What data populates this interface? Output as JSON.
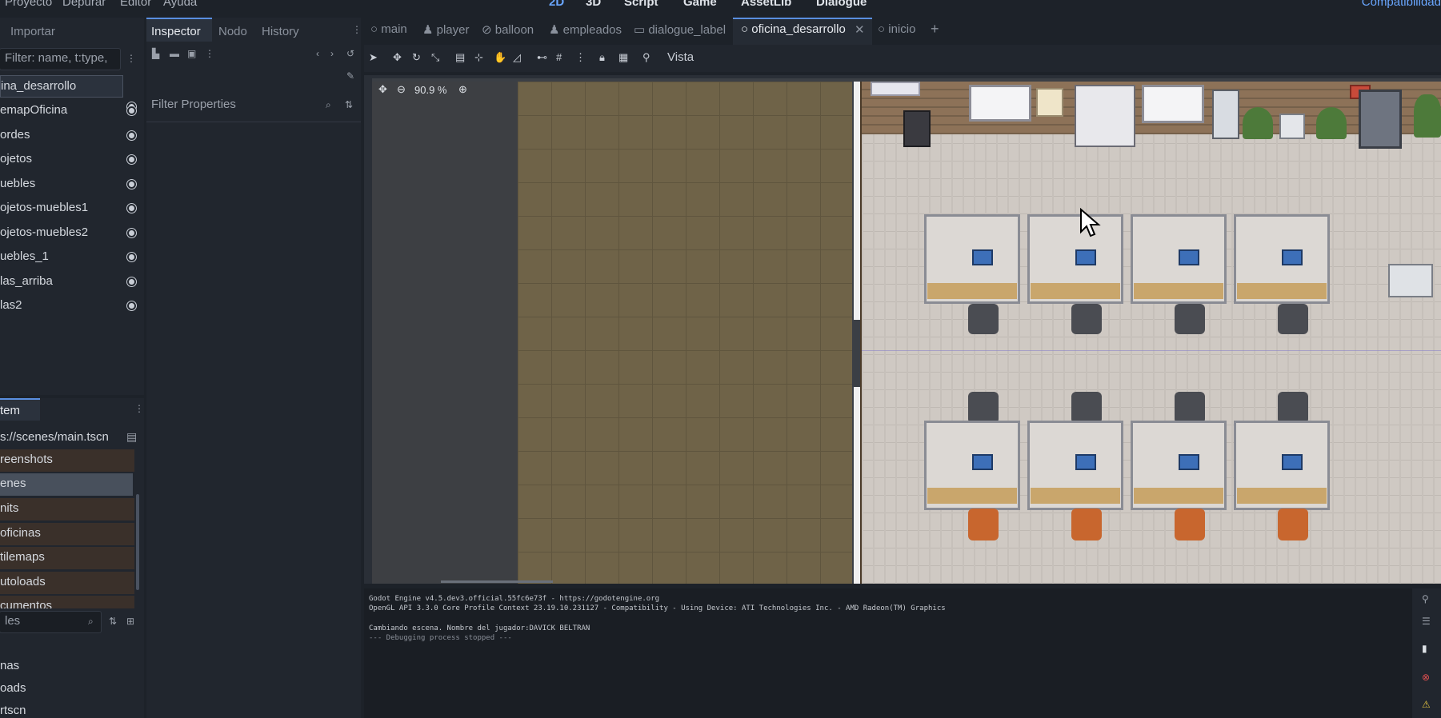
{
  "menu": {
    "items": [
      "Proyecto",
      "Depurar",
      "Editor",
      "Ayuda"
    ],
    "workspaces": [
      "2D",
      "3D",
      "Script",
      "Game",
      "AssetLib",
      "Dialogue"
    ],
    "renderer": "Compatibilidad"
  },
  "left_dock": {
    "tab": "Importar",
    "filter_placeholder": "Filter: name, t:type,",
    "tree": [
      "ina_desarrollo",
      "emapOficina",
      "ordes",
      "ojetos",
      "uebles",
      "ojetos-muebles1",
      "ojetos-muebles2",
      "uebles_1",
      "las_arriba",
      "las2"
    ],
    "fs_tab": "tem",
    "path": "s://scenes/main.tscn",
    "fs_items": [
      "reenshots",
      "enes",
      "nits",
      "oficinas",
      "tilemaps",
      "utoloads",
      "cumentos"
    ],
    "bottom_filter": "les",
    "bottom_items": [
      "nas",
      "oads",
      "rtscn"
    ]
  },
  "inspector": {
    "tabs": [
      "Inspector",
      "Nodo",
      "History"
    ],
    "filter_placeholder": "Filter Properties"
  },
  "scene_tabs": [
    "main",
    "player",
    "balloon",
    "empleados",
    "dialogue_label",
    "oficina_desarrollo",
    "inicio"
  ],
  "toolbar": {
    "vista": "Vista"
  },
  "viewport": {
    "zoom": "90.9 %"
  },
  "output": {
    "lines": [
      "Godot Engine v4.5.dev3.official.55fc6e73f - https://godotengine.org",
      "OpenGL API 3.3.0 Core Profile Context 23.19.10.231127 - Compatibility - Using Device: ATI Technologies Inc. - AMD Radeon(TM) Graphics",
      "",
      "Cambiando escena. Nombre del jugador:DAVICK BELTRAN",
      "--- Debugging process stopped ---"
    ]
  }
}
